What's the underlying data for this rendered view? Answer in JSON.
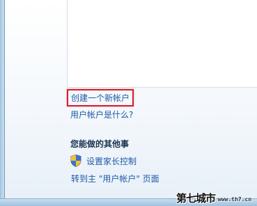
{
  "links": {
    "create_account": "创建一个新帐户",
    "what_is_account": "用户帐户是什么?",
    "parental_controls": "设置家长控制",
    "goto_user_accounts": "转到主 \"用户帐户\" 页面"
  },
  "section": {
    "title": "您能做的其他事"
  },
  "icons": {
    "parental_controls": "uac-shield-icon"
  },
  "colors": {
    "link": "#1e5aa8",
    "highlight_box": "#d6202a",
    "frame": "#b8d4ea"
  },
  "watermark": {
    "chinese": "第七城市",
    "english": "www.th7.cn"
  }
}
